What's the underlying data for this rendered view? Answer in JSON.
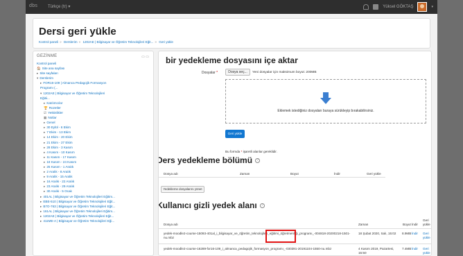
{
  "navbar": {
    "logo": "dbs",
    "language": "Türkçe (tr) ▾",
    "username": "Yüksel GÖKTAŞ",
    "avatar_caret": "▾"
  },
  "header": {
    "title": "Dersi geri yükle",
    "breadcrumb": [
      "Kontrol paneli",
      "Derslerim",
      "1202AE | Bilgisayar ve Öğretim Teknolojileri Eğit...",
      "Geri yükle"
    ]
  },
  "sidebar": {
    "title": "GEZİNME",
    "control": "▭ ▭",
    "items": [
      {
        "label": "Kontrol paneli",
        "indent": 0,
        "caret": ""
      },
      {
        "label": "Site ana sayfası",
        "indent": 0,
        "caret": "🏠"
      },
      {
        "label": "Site sayfaları",
        "indent": 0,
        "caret": "▸"
      },
      {
        "label": "Derslerim",
        "indent": 0,
        "caret": "▾"
      },
      {
        "label": "FOR16-109 | Almanca Pedagojik Formasyon",
        "indent": 1,
        "caret": "▸"
      },
      {
        "label": "Programı (...",
        "indent": 1,
        "caret": ""
      },
      {
        "label": "1202AE | Bilgisayar ve Öğretim Teknolojileri",
        "indent": 1,
        "caret": "▾"
      },
      {
        "label": "Eğitii...",
        "indent": 1,
        "caret": ""
      },
      {
        "label": "Katılımcılar",
        "indent": 2,
        "caret": "▸"
      },
      {
        "label": "Rozetler",
        "indent": 2,
        "caret": "🏆"
      },
      {
        "label": "Yetkinlikler",
        "indent": 2,
        "caret": "☑"
      },
      {
        "label": "Notlar",
        "indent": 2,
        "caret": "▦"
      },
      {
        "label": "Genel",
        "indent": 2,
        "caret": "▸"
      },
      {
        "label": "30 Eylül - 6 Ekim",
        "indent": 2,
        "caret": "▸"
      },
      {
        "label": "7 Ekim - 13 Ekim",
        "indent": 2,
        "caret": "▸"
      },
      {
        "label": "14 Ekim - 20 Ekim",
        "indent": 2,
        "caret": "▸"
      },
      {
        "label": "21 Ekim - 27 Ekim",
        "indent": 2,
        "caret": "▸"
      },
      {
        "label": "28 Ekim - 3 Kasım",
        "indent": 2,
        "caret": "▸"
      },
      {
        "label": "4 Kasım - 10 Kasım",
        "indent": 2,
        "caret": "▸"
      },
      {
        "label": "11 Kasım - 17 Kasım",
        "indent": 2,
        "caret": "▸"
      },
      {
        "label": "18 Kasım - 24 Kasım",
        "indent": 2,
        "caret": "▸"
      },
      {
        "label": "25 Kasım - 1 Aralık",
        "indent": 2,
        "caret": "▸"
      },
      {
        "label": "2 Aralık - 8 Aralık",
        "indent": 2,
        "caret": "▸"
      },
      {
        "label": "9 Aralık - 15 Aralık",
        "indent": 2,
        "caret": "▸"
      },
      {
        "label": "16 Aralık - 22 Aralık",
        "indent": 2,
        "caret": "▸"
      },
      {
        "label": "23 Aralık - 29 Aralık",
        "indent": 2,
        "caret": "▸"
      },
      {
        "label": "30 Aralık - 5 Ocak",
        "indent": 2,
        "caret": "▸"
      },
      {
        "label": "401AL | Bilgisayar ve Öğretim Teknolojileri Eğitim...",
        "indent": 1,
        "caret": "▸"
      },
      {
        "label": "EBE-510 | Bilgisayar ve Öğretim Teknolojileri Eğit...",
        "indent": 1,
        "caret": "▸"
      },
      {
        "label": "B7O-763 | Bilgisayar ve Öğretim Teknolojileri Eğit...",
        "indent": 1,
        "caret": "▸"
      },
      {
        "label": "161AL | Bilgisayar ve Öğretim Teknolojileri Eğitim...",
        "indent": 1,
        "caret": "▸"
      },
      {
        "label": "1202AE | Bilgisayar ve Öğretim Teknolojileri Eğit...",
        "indent": 1,
        "caret": "▸"
      },
      {
        "label": "411ME-A | Bilgisayar ve Öğretim Teknolojileri Eği...",
        "indent": 1,
        "caret": "▸"
      }
    ]
  },
  "import": {
    "title": "bir yedekleme dosyasını içe aktar",
    "files_label": "Dosyalar",
    "required_mark": "*",
    "choose_label": "Dosya seç...",
    "max_size": "Yeni dosyalar için maksimum boyut: 200MB",
    "drop_text": "Eklemek istediğiniz dosyaları buraya sürükleyip bırakabilirsiniz.",
    "restore_label": "Geri yükle",
    "required_note_pre": "Bu formda",
    "required_note_post": "işaretli alanlar gereklidir."
  },
  "course_backup": {
    "title": "Ders yedekleme bölümü",
    "help": "?",
    "columns": [
      "Dosya adı",
      "Zaman",
      "Boyut",
      "İndir",
      "Geri yükle"
    ],
    "manage_label": "Yedekleme dosyalarını yönet"
  },
  "private_backup": {
    "title": "Kullanıcı gizli yedek alanı",
    "help": "?",
    "columns": [
      "Dosya adı",
      "Zaman",
      "Boyut",
      "İndir",
      "Geri",
      "yükle"
    ],
    "rows": [
      {
        "name": "yedek-moodle2-course-15093-401al_i_bilgisayar_ve_öğretim_teknolojileri_eğitimi_öğretmenliği_programı_-004818-20200218-1501-nu.mbz",
        "time": "18 Şubat 2020, Salı, 15:02",
        "size": "8.9MB",
        "download": "İndir",
        "restore": "Geri",
        "restore2": "yükle"
      },
      {
        "name": "yedek-moodle2-course-16289-for16-109_i_almanca_pedagojik_formasyon_programı_-030391-20191104-1550-nu.mbz",
        "time": "4 Kasım 2019, Pazartesi,",
        "time2": "15:50",
        "size": "7.4MB",
        "download": "İndir",
        "restore": "Geri",
        "restore2": "yükle"
      }
    ]
  },
  "colors": {
    "accent": "#1177d1",
    "link": "#0a6fbf",
    "highlight": "#e01010"
  }
}
